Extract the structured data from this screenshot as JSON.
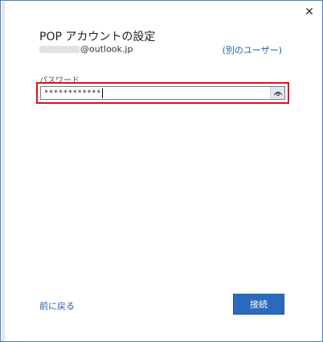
{
  "dialog": {
    "title": "POP アカウントの設定",
    "close_glyph": "✕"
  },
  "account": {
    "email_domain": "@outlook.jp",
    "other_user_label": "(別のユーザー)"
  },
  "password": {
    "label": "パスワード",
    "value": "************"
  },
  "footer": {
    "back_label": "前に戻る",
    "connect_label": "接続"
  },
  "colors": {
    "accent": "#2a6bbd",
    "link": "#1f5fae",
    "highlight": "#d7141c"
  }
}
